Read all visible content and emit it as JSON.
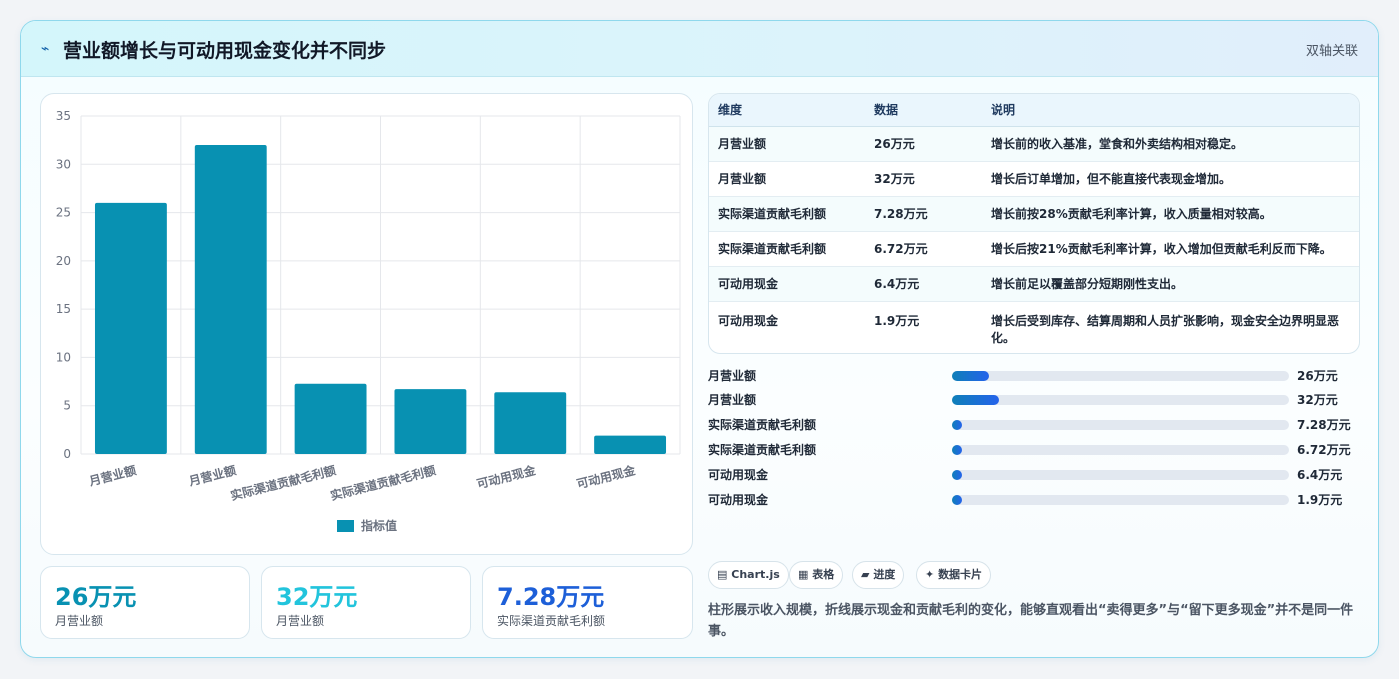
{
  "header": {
    "icon": "lightning-icon",
    "title": "营业额增长与可动用现金变化并不同步",
    "tag": "双轴关联"
  },
  "chart_data": {
    "type": "bar",
    "categories": [
      "月营业额",
      "月营业额",
      "实际渠道贡献毛利额",
      "实际渠道贡献毛利额",
      "可动用现金",
      "可动用现金"
    ],
    "series": [
      {
        "name": "指标值",
        "values": [
          26,
          32,
          7.28,
          6.72,
          6.4,
          1.9
        ]
      }
    ],
    "yticks": [
      "0",
      "5",
      "10",
      "15",
      "20",
      "25",
      "30",
      "35"
    ],
    "ylim": [
      0,
      35
    ],
    "legend": "bottom",
    "grid": true,
    "color": "#0891b2"
  },
  "stats": [
    {
      "value": "26万元",
      "label": "月营业额",
      "color": "#0891b2"
    },
    {
      "value": "32万元",
      "label": "月营业额",
      "color": "#22c4dc"
    },
    {
      "value": "7.28万元",
      "label": "实际渠道贡献毛利额",
      "color": "#1d5fd8"
    }
  ],
  "table": {
    "headers": [
      "维度",
      "数据",
      "说明"
    ],
    "rows": [
      [
        "月营业额",
        "26万元",
        "增长前的收入基准，堂食和外卖结构相对稳定。"
      ],
      [
        "月营业额",
        "32万元",
        "增长后订单增加，但不能直接代表现金增加。"
      ],
      [
        "实际渠道贡献毛利额",
        "7.28万元",
        "增长前按28%贡献毛利率计算，收入质量相对较高。"
      ],
      [
        "实际渠道贡献毛利额",
        "6.72万元",
        "增长后按21%贡献毛利率计算，收入增加但贡献毛利反而下降。"
      ],
      [
        "可动用现金",
        "6.4万元",
        "增长前足以覆盖部分短期刚性支出。"
      ],
      [
        "可动用现金",
        "1.9万元",
        "增长后受到库存、结算周期和人员扩张影响，现金安全边界明显恶化。"
      ]
    ]
  },
  "progress": [
    {
      "label": "月营业额",
      "value": "26万元",
      "fraction": 0.11
    },
    {
      "label": "月营业额",
      "value": "32万元",
      "fraction": 0.14
    },
    {
      "label": "实际渠道贡献毛利额",
      "value": "7.28万元",
      "fraction": 0.03
    },
    {
      "label": "实际渠道贡献毛利额",
      "value": "6.72万元",
      "fraction": 0.03
    },
    {
      "label": "可动用现金",
      "value": "6.4万元",
      "fraction": 0.03
    },
    {
      "label": "可动用现金",
      "value": "1.9万元",
      "fraction": 0.03
    }
  ],
  "chips": [
    {
      "icon": "chart-icon",
      "glyph": "▤",
      "label": "Chart.js"
    },
    {
      "icon": "table-icon",
      "glyph": "▦",
      "label": "表格"
    },
    {
      "icon": "progress-icon",
      "glyph": "▰",
      "label": "进度"
    },
    {
      "icon": "sparkle-icon",
      "glyph": "✦",
      "label": "数据卡片"
    }
  ],
  "note": "柱形展示收入规模，折线展示现金和贡献毛利的变化，能够直观看出“卖得更多”与“留下更多现金”并不是同一件事。"
}
